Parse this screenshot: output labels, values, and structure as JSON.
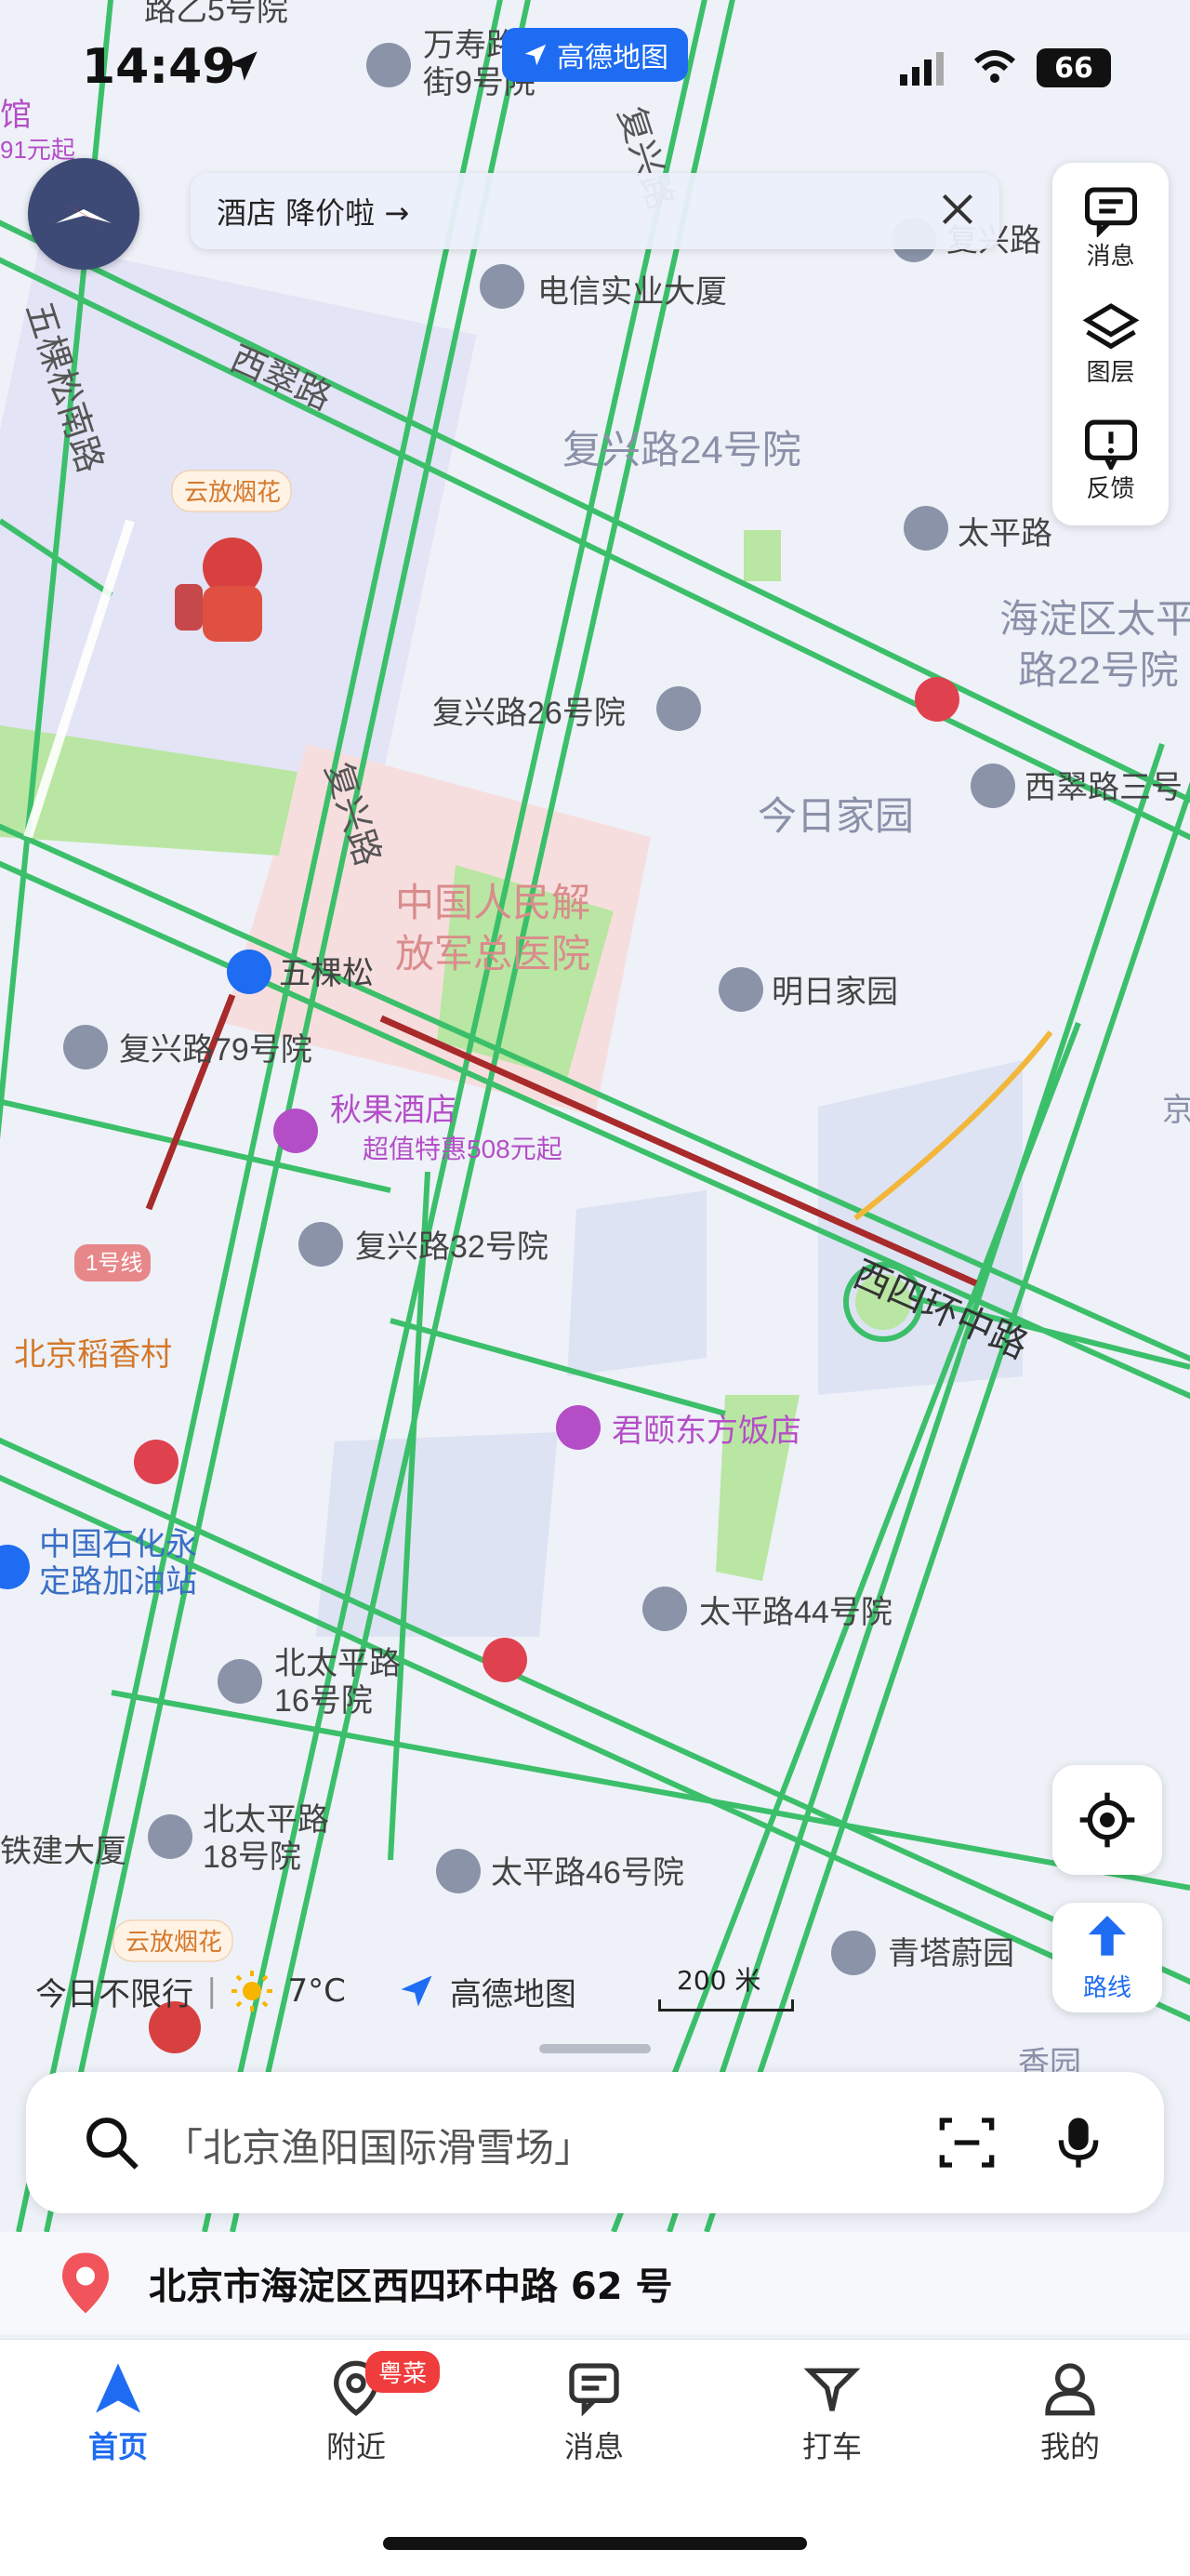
{
  "status_bar": {
    "time": "14:49",
    "app_pill": "高德地图",
    "battery": "66"
  },
  "promo_banner": {
    "text": "酒店 降价啦 →"
  },
  "side_panel": {
    "messages": "消息",
    "layers": "图层",
    "feedback": "反馈"
  },
  "map": {
    "labels": {
      "top_left_a": "路乙5号院",
      "top_left_b": "馆",
      "top_left_c": "91元起",
      "wanshou": "万寿路\n街9号院",
      "fuxing_road_vert_top": "复兴路",
      "fuxing_top_right": "复兴路",
      "dianxin": "电信实业大厦",
      "wukesong_nan": "五棵松南路",
      "xicui": "西翠路",
      "fuxing24": "复兴路24号院",
      "taiping_top": "太平路",
      "haidian_taiping22": "海淀区太平\n路22号院",
      "fuxing26": "复兴路26号院",
      "jinri": "今日家园",
      "xicui3": "西翠路三号",
      "fireworks_1": "云放烟花",
      "fireworks_2": "云放烟花",
      "fuxing_road_vert": "复兴路",
      "hospital": "中国人民解\n放军总医院",
      "wukesong_station": "五棵松",
      "mingri": "明日家园",
      "fuxing79": "复兴路79号院",
      "qiuguo": "秋果酒店",
      "qiuguo_deal": "超值特惠508元起",
      "jing": "京",
      "line1": "1号线",
      "fuxing32": "复兴路32号院",
      "xisihuan": "西四环中路",
      "daoxiang": "北京稻香村",
      "junyi": "君颐东方饭店",
      "sinopec": "中国石化永\n定路加油站",
      "taiping44": "太平路44号院",
      "beitaiping16": "北太平路\n16号院",
      "beitaiping18": "北太平路\n18号院",
      "tiejian": "铁建大厦",
      "taiping46": "太平路46号院",
      "qingta": "青塔蔚园",
      "xiangyuan": "香园"
    }
  },
  "map_controls": {
    "route_label": "路线"
  },
  "info_row": {
    "no_restriction": "今日不限行",
    "temperature": "7°C",
    "brand": "高德地图",
    "scale": "200 米"
  },
  "search": {
    "placeholder": "「北京渔阳国际滑雪场」"
  },
  "current_location": {
    "address": "北京市海淀区西四环中路 62 号"
  },
  "tabbar": {
    "home": "首页",
    "nearby": "附近",
    "nearby_badge": "粤菜",
    "messages": "消息",
    "taxi": "打车",
    "mine": "我的"
  },
  "colors": {
    "accent": "#1e6cf2",
    "road": "#3cbf6a",
    "congested": "#a82a2a",
    "hospital_area": "#f9dede",
    "park": "#aee29a",
    "poi_purple": "#b44ec7",
    "poi_orange": "#d4782a"
  }
}
